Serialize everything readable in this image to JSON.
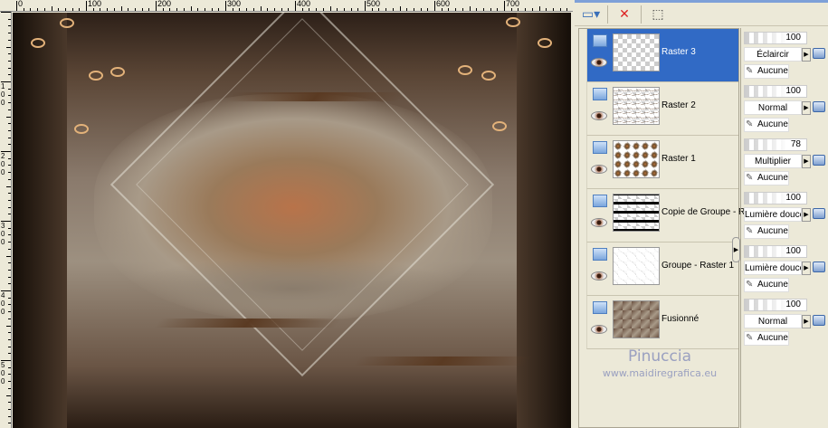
{
  "ruler": {
    "top_labels": [
      "0",
      "100",
      "200",
      "300",
      "400",
      "500",
      "600",
      "700"
    ],
    "left_labels": [
      "100",
      "200",
      "300",
      "400",
      "500"
    ]
  },
  "toolbar": {
    "buttons": [
      {
        "name": "new-layer",
        "icon": "new-layer-icon"
      },
      {
        "name": "delete-layer",
        "icon": "delete-layer-icon"
      },
      {
        "name": "edit-selection",
        "icon": "edit-selection-icon"
      }
    ]
  },
  "layers": [
    {
      "name": "Raster 3",
      "opacity": "100",
      "blend": "Éclaircir",
      "mask": "Aucune",
      "selected": true
    },
    {
      "name": "Raster 2",
      "opacity": "100",
      "blend": "Normal",
      "mask": "Aucune"
    },
    {
      "name": "Raster 1",
      "opacity": "78",
      "blend": "Multiplier",
      "mask": "Aucune"
    },
    {
      "name": "Copie de Groupe - R",
      "opacity": "100",
      "blend": "Lumière douce",
      "mask": "Aucune"
    },
    {
      "name": "Groupe - Raster 1",
      "opacity": "100",
      "blend": "Lumière douce",
      "mask": "Aucune"
    },
    {
      "name": "Fusionné",
      "opacity": "100",
      "blend": "Normal",
      "mask": "Aucune"
    }
  ],
  "signature": {
    "name": "Pinuccia",
    "url": "www.maidiregrafica.eu"
  }
}
